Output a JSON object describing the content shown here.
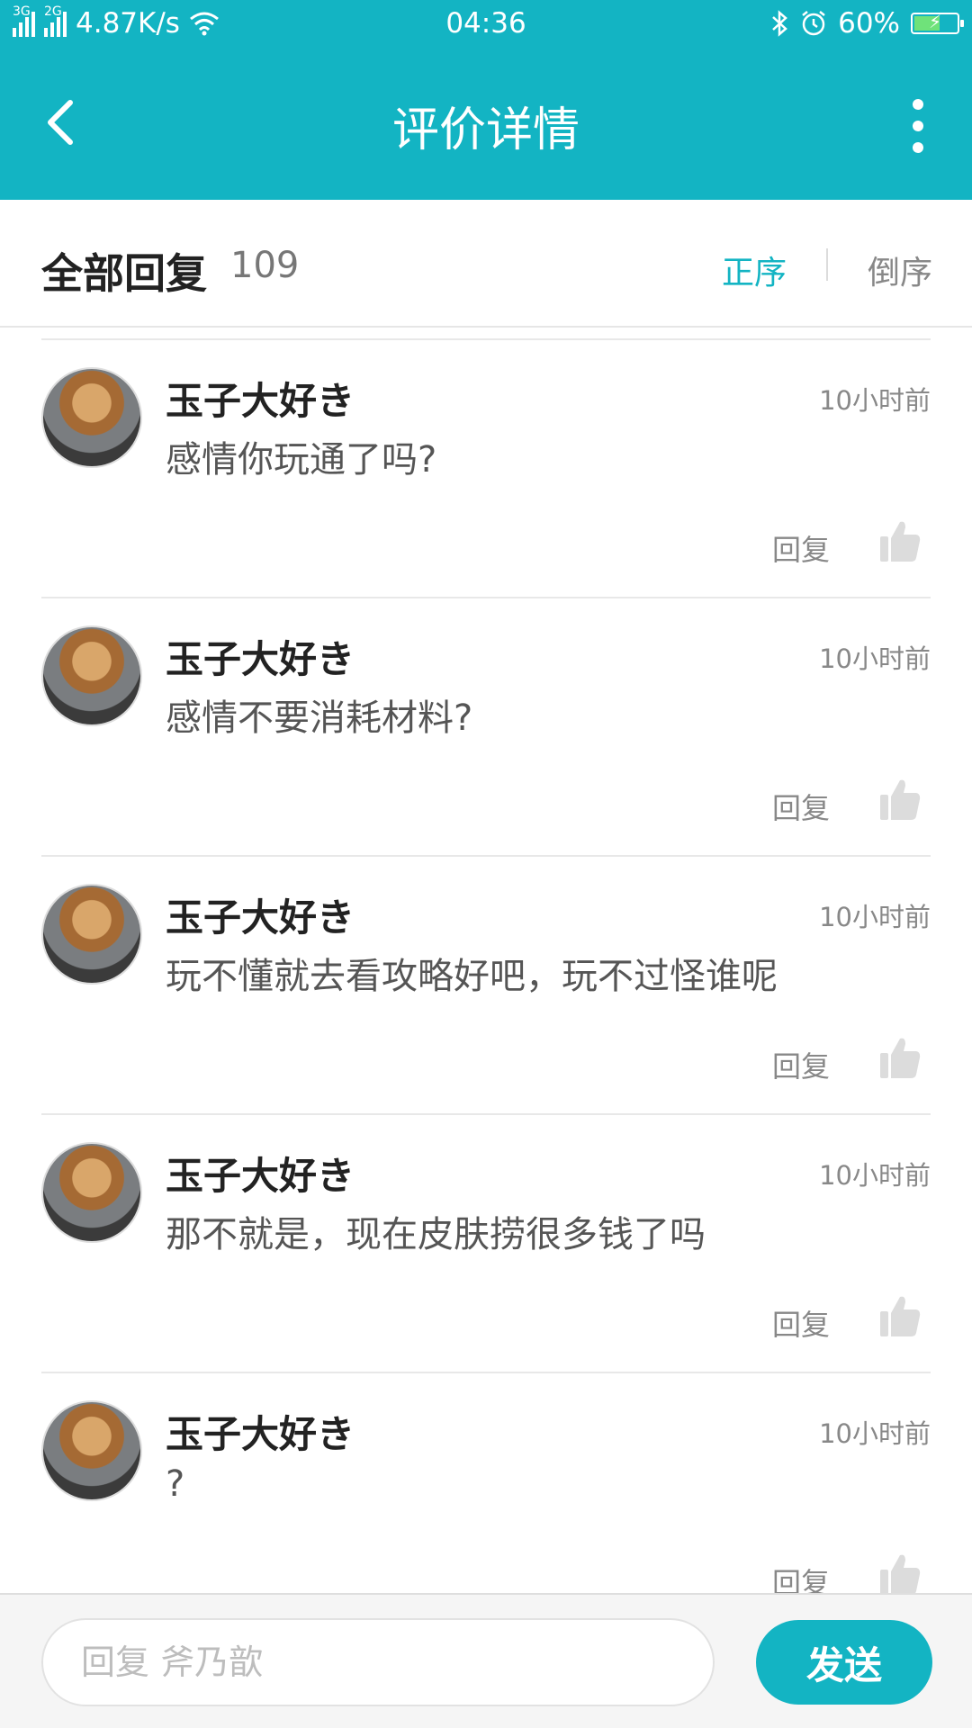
{
  "status_bar": {
    "network_1": "3G",
    "network_2": "2G",
    "speed": "4.87K/s",
    "time": "04:36",
    "battery": "60%",
    "battery_level": 0.6
  },
  "header": {
    "title": "评价详情"
  },
  "replies_header": {
    "label": "全部回复",
    "count": "109",
    "sort_asc": "正序",
    "sort_desc": "倒序",
    "active_sort": "正序"
  },
  "comments": [
    {
      "user": "玉子大好き",
      "time": "10小时前",
      "text": "感情你玩通了吗?",
      "reply": "回复"
    },
    {
      "user": "玉子大好き",
      "time": "10小时前",
      "text": "感情不要消耗材料?",
      "reply": "回复"
    },
    {
      "user": "玉子大好き",
      "time": "10小时前",
      "text": "玩不懂就去看攻略好吧，玩不过怪谁呢",
      "reply": "回复"
    },
    {
      "user": "玉子大好き",
      "time": "10小时前",
      "text": "那不就是，现在皮肤捞很多钱了吗",
      "reply": "回复"
    },
    {
      "user": "玉子大好き",
      "time": "10小时前",
      "text": "?",
      "reply": "回复"
    }
  ],
  "bottom_bar": {
    "placeholder": "回复 斧乃歆",
    "send_label": "发送"
  },
  "colors": {
    "accent": "#13b4c3",
    "like_icon": "#dcdcdc"
  }
}
